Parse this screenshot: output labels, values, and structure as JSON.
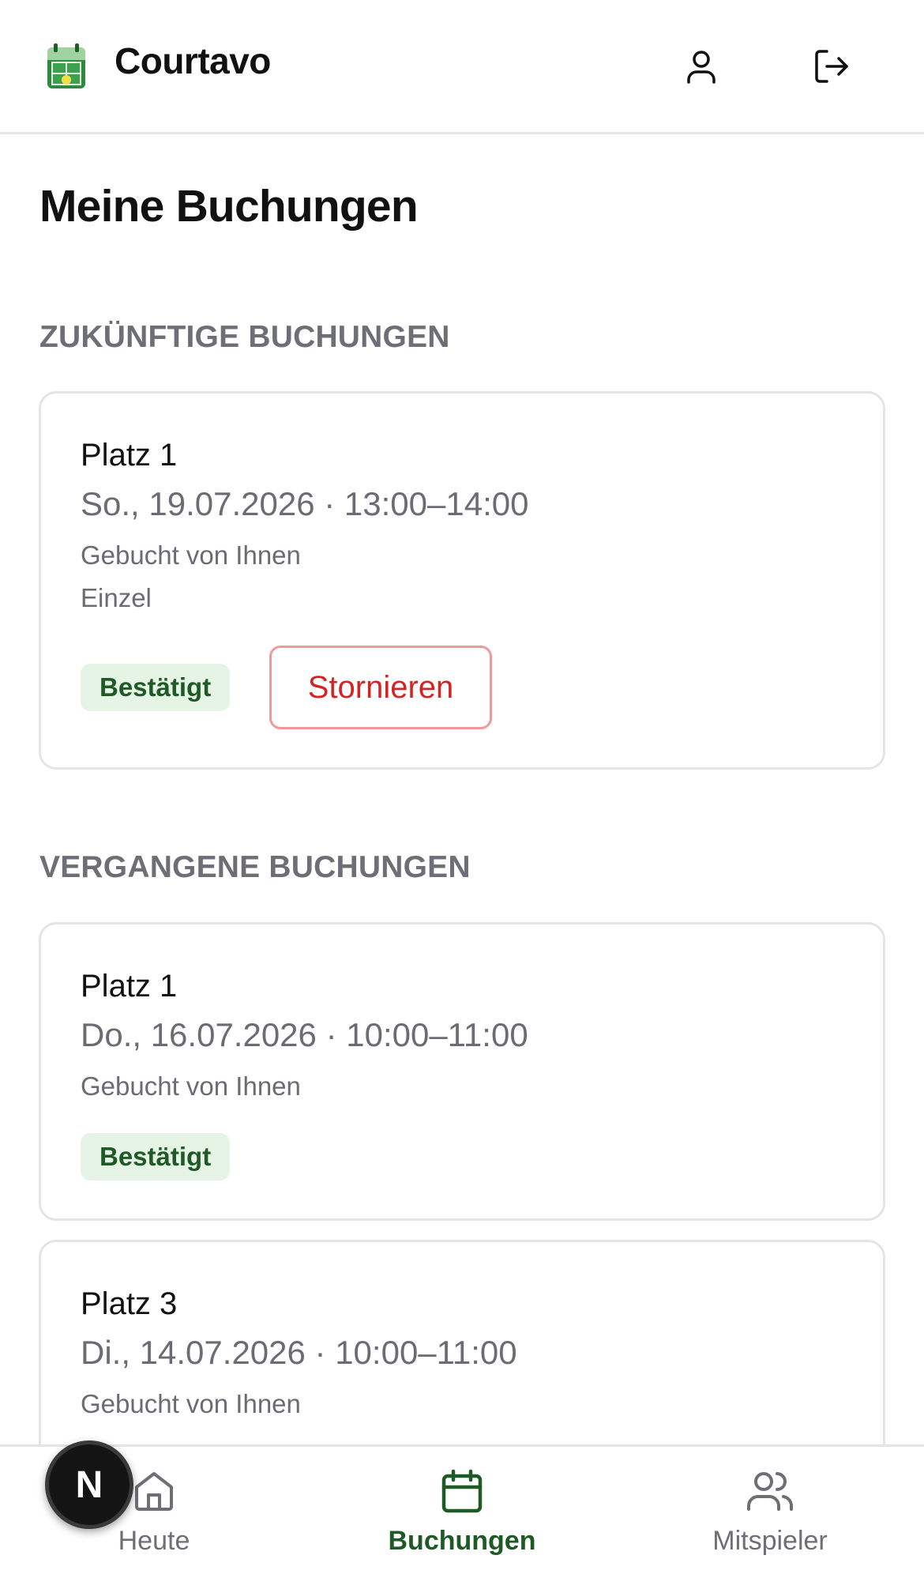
{
  "header": {
    "brand": "Courtavo",
    "logo_icon": "court-calendar-icon",
    "profile_icon": "user-icon",
    "logout_icon": "logout-icon"
  },
  "page": {
    "title": "Meine Buchungen"
  },
  "upcoming": {
    "title": "ZUKÜNFTIGE BUCHUNGEN",
    "bookings": [
      {
        "court": "Platz 1",
        "datetime": "So., 19.07.2026 · 13:00–14:00",
        "booked_by": "Gebucht von Ihnen",
        "type": "Einzel",
        "status": "Bestätigt",
        "cancel_label": "Stornieren"
      }
    ]
  },
  "past": {
    "title": "VERGANGENE BUCHUNGEN",
    "bookings": [
      {
        "court": "Platz 1",
        "datetime": "Do., 16.07.2026 · 10:00–11:00",
        "booked_by": "Gebucht von Ihnen",
        "status": "Bestätigt"
      },
      {
        "court": "Platz 3",
        "datetime": "Di., 14.07.2026 · 10:00–11:00",
        "booked_by": "Gebucht von Ihnen"
      }
    ]
  },
  "nav": {
    "items": [
      {
        "label": "Heute",
        "icon": "home-icon",
        "active": false
      },
      {
        "label": "Buchungen",
        "icon": "calendar-icon",
        "active": true
      },
      {
        "label": "Mitspieler",
        "icon": "users-icon",
        "active": false
      }
    ]
  },
  "dev_badge": {
    "letter": "N"
  },
  "colors": {
    "accent_green": "#1f5a26",
    "badge_bg": "#e6f4e6",
    "danger": "#d32323",
    "muted": "#6e6e76"
  }
}
